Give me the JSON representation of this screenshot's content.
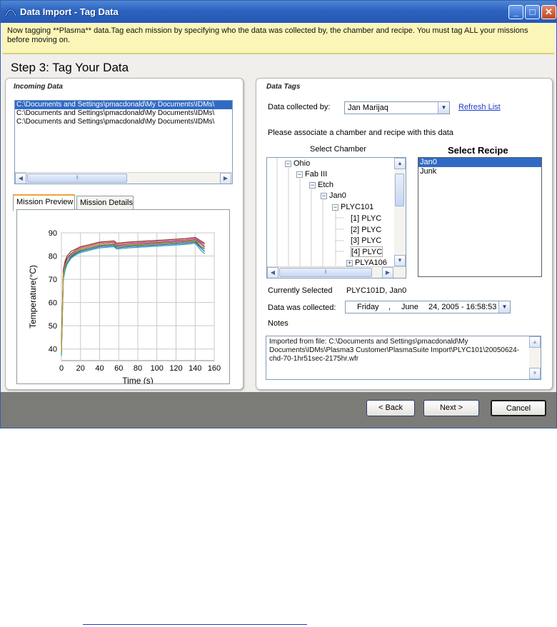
{
  "window": {
    "title": "Data Import - Tag Data",
    "banner": "Now tagging **Plasma** data.Tag each mission by specifying who the data was collected by, the chamber and recipe.  You must tag ALL your missions before moving on.",
    "step_title": "Step 3: Tag Your Data"
  },
  "incoming": {
    "title": "Incoming Data",
    "files": [
      "C:\\Documents and Settings\\pmacdonald\\My Documents\\IDMs\\",
      "C:\\Documents and Settings\\pmacdonald\\My Documents\\IDMs\\",
      "C:\\Documents and Settings\\pmacdonald\\My Documents\\IDMs\\"
    ]
  },
  "tabs": [
    "Mission Preview",
    "Mission Details"
  ],
  "chart_data": {
    "type": "line",
    "xlabel": "Time (s)",
    "ylabel": "Temperature(°C)",
    "xlim": [
      0,
      160
    ],
    "ylim": [
      35,
      90
    ],
    "xticks": [
      0,
      20,
      40,
      60,
      80,
      100,
      120,
      140,
      160
    ],
    "yticks": [
      40,
      50,
      60,
      70,
      80,
      90
    ],
    "grid": true,
    "series": [
      {
        "color": "#d43b8f",
        "x": [
          0,
          2,
          4,
          6,
          10,
          15,
          20,
          30,
          40,
          55,
          58,
          70,
          90,
          110,
          130,
          140,
          146,
          150
        ],
        "y": [
          39,
          73,
          77,
          79,
          81,
          82.5,
          83.5,
          84.5,
          85.5,
          86,
          85,
          85.5,
          86,
          86.5,
          87,
          87.5,
          86,
          85
        ]
      },
      {
        "color": "#2f7e3a",
        "x": [
          0,
          2,
          4,
          6,
          10,
          15,
          20,
          30,
          40,
          55,
          58,
          70,
          90,
          110,
          130,
          140,
          146,
          150
        ],
        "y": [
          38,
          72,
          76,
          78,
          80,
          81.5,
          82.5,
          83.5,
          84.5,
          85,
          84,
          84.5,
          85,
          85.5,
          86,
          86.5,
          84,
          83
        ]
      },
      {
        "color": "#3b56c4",
        "x": [
          0,
          2,
          4,
          6,
          10,
          15,
          20,
          30,
          40,
          55,
          58,
          70,
          90,
          110,
          130,
          140,
          146,
          150
        ],
        "y": [
          40,
          71,
          75,
          77,
          79.5,
          81,
          82,
          83,
          84,
          84.5,
          83.5,
          84,
          84.5,
          85,
          85.5,
          86,
          83.5,
          82
        ]
      },
      {
        "color": "#8a3a1f",
        "x": [
          0,
          2,
          4,
          6,
          10,
          15,
          20,
          30,
          40,
          55,
          58,
          70,
          90,
          110,
          130,
          140,
          146,
          150
        ],
        "y": [
          42,
          74,
          78,
          80,
          82,
          83,
          84,
          85,
          86,
          86.5,
          85.5,
          86,
          86.5,
          87,
          87.5,
          88,
          86.5,
          85.5
        ]
      },
      {
        "color": "#20a3b0",
        "x": [
          0,
          2,
          4,
          6,
          10,
          15,
          20,
          30,
          40,
          55,
          58,
          70,
          90,
          110,
          130,
          140,
          146,
          150
        ],
        "y": [
          37,
          70,
          74,
          76.5,
          79,
          80.5,
          81.5,
          82.5,
          83.5,
          84,
          83,
          83.5,
          84,
          84.5,
          85,
          85.5,
          82.5,
          81
        ]
      },
      {
        "color": "#7a2a8e",
        "x": [
          0,
          2,
          4,
          6,
          10,
          15,
          20,
          30,
          40,
          55,
          58,
          70,
          90,
          110,
          130,
          140,
          146,
          150
        ],
        "y": [
          41,
          73,
          77,
          79,
          81,
          82,
          83,
          84,
          85,
          85.5,
          84.5,
          85,
          85.5,
          86,
          86.5,
          87,
          85.5,
          84
        ]
      },
      {
        "color": "#c2a51f",
        "x": [
          0,
          2,
          4,
          6,
          10,
          15,
          20,
          30,
          40,
          55,
          58,
          70,
          90,
          110,
          130,
          140,
          146,
          150
        ],
        "y": [
          39,
          72,
          76,
          78,
          80.5,
          82,
          83,
          84,
          85,
          85.5,
          84.2,
          84.8,
          85.2,
          85.8,
          86.2,
          86.8,
          84.8,
          83.5
        ]
      }
    ]
  },
  "tags": {
    "title": "Data Tags",
    "collected_by_label": "Data collected by:",
    "collected_by_value": "Jan Marijaq",
    "refresh_label": "Refresh List",
    "associate_text": "Please associate a chamber and recipe with this data",
    "select_chamber_label": "Select Chamber",
    "select_recipe_label": "Select Recipe",
    "tree": [
      {
        "label": "Ohio",
        "expander": "−"
      },
      {
        "label": "Fab III",
        "expander": "−"
      },
      {
        "label": "Etch",
        "expander": "−"
      },
      {
        "label": "Jan0",
        "expander": "−"
      },
      {
        "label": "PLYC101",
        "expander": "−"
      },
      {
        "label": "[1] PLYC"
      },
      {
        "label": "[2] PLYC"
      },
      {
        "label": "[3] PLYC"
      },
      {
        "label": "[4] PLYC"
      },
      {
        "label": "PLYA106",
        "expander": "+"
      }
    ],
    "recipes": [
      "Jan0",
      "Junk"
    ],
    "currently_selected_label": "Currently Selected",
    "currently_selected_value": "PLYC101D, Jan0",
    "collected_date_label": "Data was collected:",
    "date_day": "Friday",
    "date_sep": ",",
    "date_month": "June",
    "date_rest": "24, 2005 - 16:58:53",
    "notes_label": "Notes",
    "notes_text": "Imported from file: C:\\Documents and Settings\\pmacdonald\\My Documents\\IDMs\\Plasma3 Customer\\PlasmaSuite Import\\PLYC101\\20050624-chd-70-1hr51sec-2175hr.wfr"
  },
  "buttons": {
    "back": "< Back",
    "next": "Next >",
    "cancel": "Cancel"
  }
}
